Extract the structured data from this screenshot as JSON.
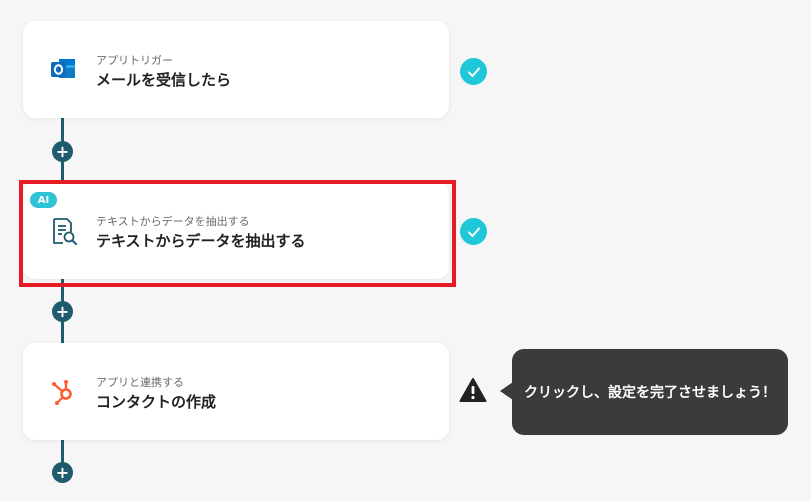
{
  "steps": [
    {
      "icon": "outlook-icon",
      "subtitle": "アプリトリガー",
      "title": "メールを受信したら",
      "ai_badge": "",
      "status": "check-icon"
    },
    {
      "icon": "document-search-icon",
      "subtitle": "テキストからデータを抽出する",
      "title": "テキストからデータを抽出する",
      "ai_badge": "AI",
      "status": "check-icon"
    },
    {
      "icon": "hubspot-icon",
      "subtitle": "アプリと連携する",
      "title": "コンタクトの作成",
      "ai_badge": "",
      "status": "warning-icon"
    }
  ],
  "add_step_label": "+",
  "tooltip": {
    "text": "クリックし、設定を完了させましょう！"
  },
  "colors": {
    "connector": "#1f5a6e",
    "check": "#1fc7d9",
    "highlight": "#e51c23",
    "ai_badge": "#2ec4d6",
    "tooltip_bg": "#3b3b3b"
  }
}
